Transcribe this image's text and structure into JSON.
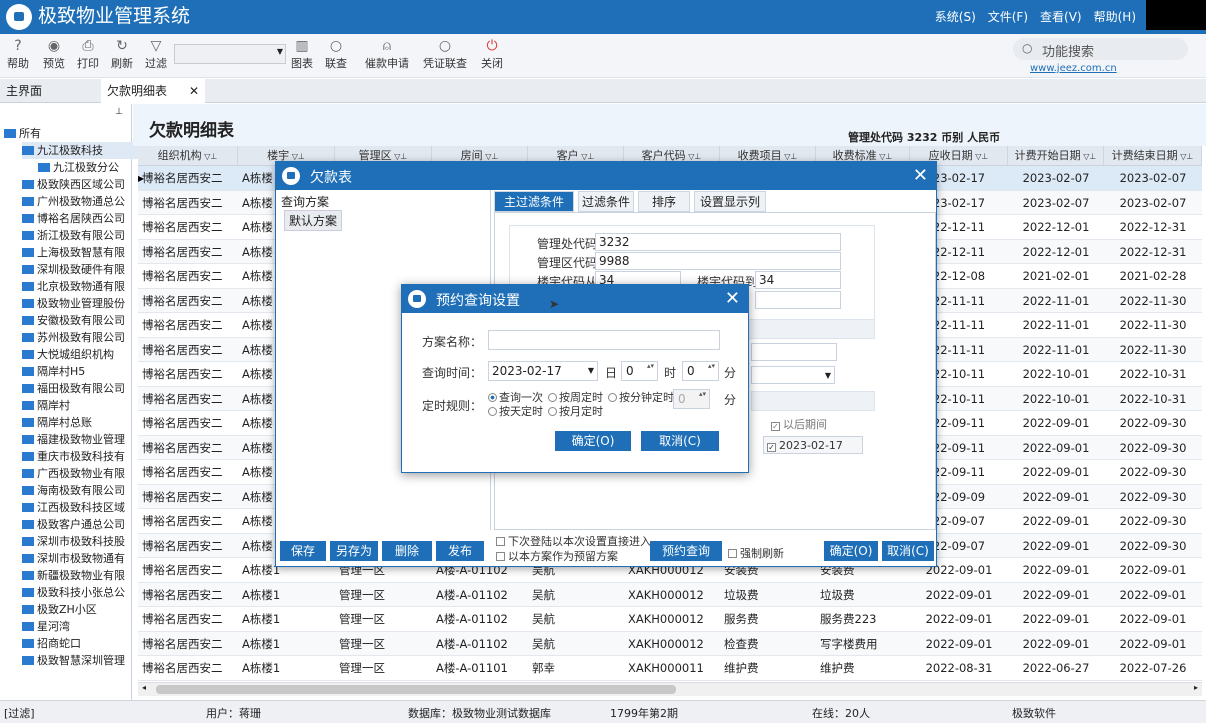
{
  "app": {
    "title": "极致物业管理系统"
  },
  "menu": [
    "系统(S)",
    "文件(F)",
    "查看(V)",
    "帮助(H)"
  ],
  "toolbar": {
    "buttons": [
      "帮助",
      "预览",
      "打印",
      "刷新",
      "过滤",
      "图表",
      "联查",
      "催款申请",
      "凭证联查",
      "关闭"
    ],
    "func_search": "功能搜索",
    "website": "www.jeez.com.cn"
  },
  "tabs": [
    "主界面",
    "欠款明细表"
  ],
  "tree": [
    "所有",
    "九江极致科技",
    "九江极致分公",
    "极致陕西区域公司",
    "广州极致物通总公",
    "博裕名居陕西公司",
    "浙江极致有限公司",
    "上海极致智慧有限",
    "深圳极致硬件有限",
    "北京极致物通有限",
    "极致物业管理股份",
    "安徽极致有限公司",
    "苏州极致有限公司",
    "大悦城组织机构",
    "隔岸村H5",
    "福田极致有限公司",
    "隔岸村",
    "隔岸村总账",
    "福建极致物业管理",
    "重庆市极致科技有",
    "广西极致物业有限",
    "海南极致有限公司",
    "江西极致科技区域",
    "极致客户通总公司",
    "深圳市极致科技股",
    "深圳市极致物通有",
    "新疆极致物业有限",
    "极致科技小张总公",
    "极致ZH小区",
    "星河湾",
    "招商蛇口",
    "极致智慧深圳管理"
  ],
  "report": {
    "title": "欠款明细表",
    "sub": "管理处代码 3232 币别 人民币"
  },
  "columns": [
    "组织机构",
    "楼宇",
    "管理区",
    "房间",
    "客户",
    "客户代码",
    "收费项目",
    "收费标准",
    "应收日期",
    "计费开始日期",
    "计费结束日期"
  ],
  "rows": [
    {
      "org": "博裕名居西安二",
      "bld": "A栋楼",
      "due": "23-02-17",
      "start": "2023-02-07",
      "end": "2023-02-07"
    },
    {
      "org": "博裕名居西安二",
      "bld": "A栋楼",
      "due": "23-02-17",
      "start": "2023-02-07",
      "end": "2023-02-07"
    },
    {
      "org": "博裕名居西安二",
      "bld": "A栋楼",
      "due": "22-12-11",
      "start": "2022-12-01",
      "end": "2022-12-31"
    },
    {
      "org": "博裕名居西安二",
      "bld": "A栋楼",
      "due": "22-12-11",
      "start": "2022-12-01",
      "end": "2022-12-31"
    },
    {
      "org": "博裕名居西安二",
      "bld": "A栋楼",
      "due": "22-12-08",
      "start": "2021-02-01",
      "end": "2021-02-28"
    },
    {
      "org": "博裕名居西安二",
      "bld": "A栋楼",
      "due": "22-11-11",
      "start": "2022-11-01",
      "end": "2022-11-30"
    },
    {
      "org": "博裕名居西安二",
      "bld": "A栋楼",
      "due": "22-11-11",
      "start": "2022-11-01",
      "end": "2022-11-30"
    },
    {
      "org": "博裕名居西安二",
      "bld": "A栋楼",
      "due": "22-11-11",
      "start": "2022-11-01",
      "end": "2022-11-30"
    },
    {
      "org": "博裕名居西安二",
      "bld": "A栋楼",
      "due": "22-10-11",
      "start": "2022-10-01",
      "end": "2022-10-31"
    },
    {
      "org": "博裕名居西安二",
      "bld": "A栋楼",
      "due": "22-10-11",
      "start": "2022-10-01",
      "end": "2022-10-31"
    },
    {
      "org": "博裕名居西安二",
      "bld": "A栋楼",
      "due": "22-09-11",
      "start": "2022-09-01",
      "end": "2022-09-30"
    },
    {
      "org": "博裕名居西安二",
      "bld": "A栋楼",
      "due": "22-09-11",
      "start": "2022-09-01",
      "end": "2022-09-30"
    },
    {
      "org": "博裕名居西安二",
      "bld": "A栋楼",
      "due": "22-09-11",
      "start": "2022-09-01",
      "end": "2022-09-30"
    },
    {
      "org": "博裕名居西安二",
      "bld": "A栋楼",
      "due": "22-09-09",
      "start": "2022-09-01",
      "end": "2022-09-30"
    },
    {
      "org": "博裕名居西安二",
      "bld": "A栋楼",
      "due": "22-09-07",
      "start": "2022-09-01",
      "end": "2022-09-30"
    },
    {
      "org": "博裕名居西安二",
      "bld": "A栋楼",
      "due": "22-09-07",
      "start": "2022-09-01",
      "end": "2022-09-30"
    },
    {
      "org": "博裕名居西安二",
      "bld": "A栋楼1",
      "area": "管理一区",
      "room": "A楼-A-01102",
      "cust": "吴航",
      "code": "XAKH000012",
      "item": "安装费",
      "std": "安装费",
      "due": "2022-09-01",
      "start": "2022-09-01",
      "end": "2022-09-01"
    },
    {
      "org": "博裕名居西安二",
      "bld": "A栋楼1",
      "area": "管理一区",
      "room": "A楼-A-01102",
      "cust": "吴航",
      "code": "XAKH000012",
      "item": "垃圾费",
      "std": "垃圾费",
      "due": "2022-09-01",
      "start": "2022-09-01",
      "end": "2022-09-01"
    },
    {
      "org": "博裕名居西安二",
      "bld": "A栋楼1",
      "area": "管理一区",
      "room": "A楼-A-01102",
      "cust": "吴航",
      "code": "XAKH000012",
      "item": "服务费",
      "std": "服务费223",
      "due": "2022-09-01",
      "start": "2022-09-01",
      "end": "2022-09-01"
    },
    {
      "org": "博裕名居西安二",
      "bld": "A栋楼1",
      "area": "管理一区",
      "room": "A楼-A-01102",
      "cust": "吴航",
      "code": "XAKH000012",
      "item": "检查费",
      "std": "写字楼费用",
      "due": "2022-09-01",
      "start": "2022-09-01",
      "end": "2022-09-01"
    },
    {
      "org": "博裕名居西安二",
      "bld": "A栋楼1",
      "area": "管理一区",
      "room": "A楼-A-01101",
      "cust": "郭幸",
      "code": "XAKH000011",
      "item": "维护费",
      "std": "维护费",
      "due": "2022-08-31",
      "start": "2022-06-27",
      "end": "2022-07-26"
    }
  ],
  "status": {
    "filter": "[过滤]",
    "user": "用户：蒋珊",
    "db": "数据库：极致物业测试数据库",
    "period": "1799年第2期",
    "online": "在线：20人",
    "vendor": "极致软件"
  },
  "dlg1": {
    "title": "欠款表",
    "left_header": "查询方案",
    "default_scheme": "默认方案",
    "tabs": [
      "主过滤条件",
      "过滤条件",
      "排序",
      "设置显示列"
    ],
    "fields": {
      "mgmt_code_label": "管理处代码",
      "mgmt_code": "3232",
      "area_code_label": "管理区代码",
      "area_code": "9988",
      "bld_from_label": "楼宇代码从",
      "bld_from": "34",
      "bld_to_label": "楼宇代码到",
      "bld_to": "34"
    },
    "later_period": "以后期间",
    "later_date": "2023-02-17",
    "buttons": {
      "save": "保存",
      "save_as": "另存为",
      "delete": "删除",
      "publish": "发布",
      "schedule": "预约查询",
      "ok": "确定(O)",
      "cancel": "取消(C)"
    },
    "chk1": "下次登陆以本次设置直接进入",
    "chk2": "以本方案作为预留方案",
    "chk3": "强制刷新"
  },
  "dlg2": {
    "title": "预约查询设置",
    "name_label": "方案名称：",
    "time_label": "查询时间：",
    "date": "2023-02-17",
    "day": "日",
    "hour": "0",
    "hour_unit": "时",
    "min": "0",
    "min_unit": "分",
    "rule_label": "定时规则：",
    "radios": [
      "查询一次",
      "按周定时",
      "按分钟定时",
      "按天定时",
      "按月定时"
    ],
    "interval": "0",
    "ok": "确定(O)",
    "cancel": "取消(C)"
  }
}
